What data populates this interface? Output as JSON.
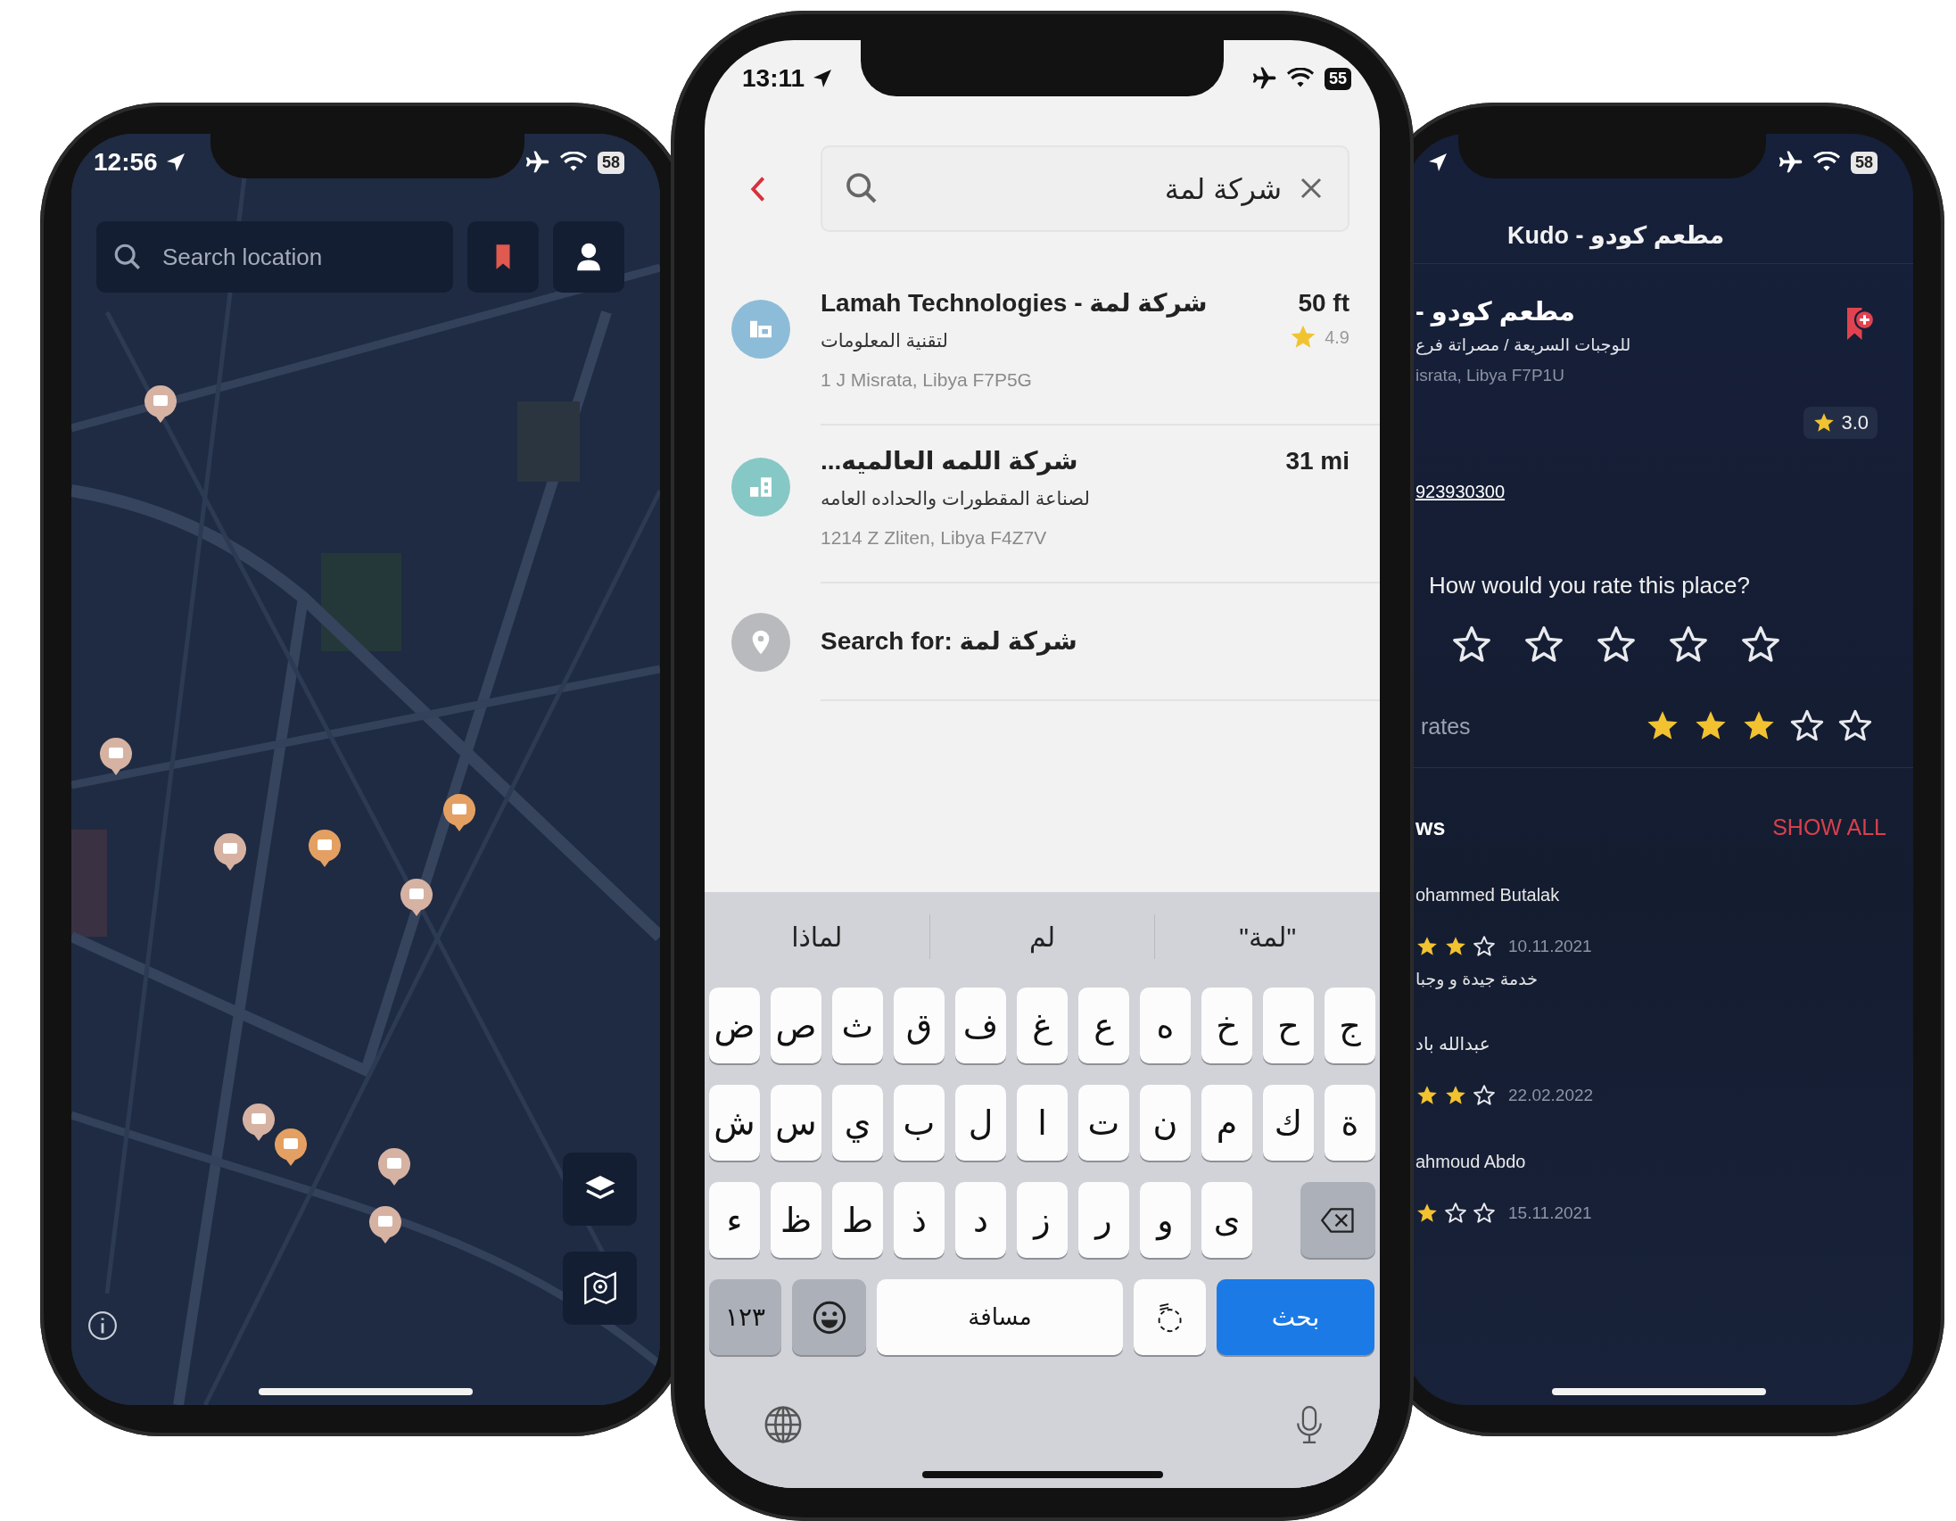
{
  "map_screen": {
    "status": {
      "time": "12:56",
      "battery": "58"
    },
    "search": {
      "placeholder": "Search location"
    }
  },
  "search_screen": {
    "status": {
      "time": "13:11",
      "battery": "55"
    },
    "search": {
      "value": "شركة لمة"
    },
    "results": [
      {
        "kind": "office",
        "color": "#8dbcd8",
        "title": "Lamah Technologies - شركة لمة",
        "subtitle": "لتقنية المعلومات",
        "address": "1 J Misrata, Libya F7P5G",
        "distance": "50 ft",
        "rating": "4.9"
      },
      {
        "kind": "factory",
        "color": "#86c8c6",
        "title": "شركة اللمه العالميه...",
        "subtitle": "لصناعة المقطورات والحداده العامه",
        "address": "1214 Z Zliten, Libya F4Z7V",
        "distance": "31 mi"
      },
      {
        "kind": "query",
        "color": "#b9babd",
        "title": "Search for: شركة لمة"
      }
    ],
    "keyboard": {
      "suggestions": [
        "\"لمة\"",
        "لم",
        "لماذا"
      ],
      "rows": [
        [
          "ج",
          "ح",
          "خ",
          "ه",
          "ع",
          "غ",
          "ف",
          "ق",
          "ث",
          "ص",
          "ض"
        ],
        [
          "ة",
          "ك",
          "م",
          "ن",
          "ت",
          "ا",
          "ل",
          "ب",
          "ي",
          "س",
          "ش"
        ],
        [
          "",
          "",
          "ى",
          "و",
          "ر",
          "ز",
          "د",
          "ذ",
          "ط",
          "ظ",
          "ء"
        ]
      ],
      "numbers_key": "١٢٣",
      "space_key": "مسافة",
      "tanween_key": "◌ً",
      "search_key": "بحث"
    }
  },
  "place_screen": {
    "status": {
      "battery": "58"
    },
    "title": "Kudo - مطعم كودو",
    "name": "مطعم كودو -",
    "category": "للوجبات السريعة / مصراتة فرع",
    "address": "israta, Libya F7P1U",
    "rating": "3.0",
    "phone": "923930300",
    "rate_prompt": "How would you rate this place?",
    "rate_row": {
      "stars": 0
    },
    "rates": {
      "label": "rates",
      "stars": 3
    },
    "reviews_title": "ws",
    "show_all": "SHOW ALL",
    "reviews": [
      {
        "author": "ohammed Butalak",
        "stars": 2,
        "date": "10.11.2021",
        "text": "خدمة جيدة و وجبا"
      },
      {
        "author": "عبدالله باد",
        "stars": 2,
        "date": "22.02.2022"
      },
      {
        "author": "ahmoud Abdo",
        "stars": 1,
        "date": "15.11.2021"
      }
    ]
  }
}
